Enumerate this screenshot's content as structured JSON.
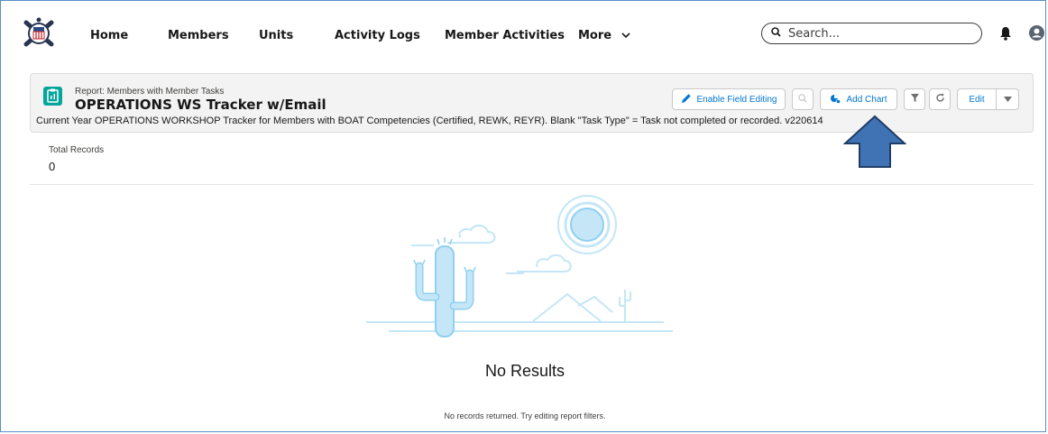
{
  "nav": {
    "items": [
      "Home",
      "Members",
      "Units",
      "Activity Logs",
      "Member Activities"
    ],
    "more_label": "More",
    "search_placeholder": "Search..."
  },
  "report": {
    "kicker": "Report: Members with Member Tasks",
    "title": "OPERATIONS WS Tracker w/Email",
    "description": "Current Year OPERATIONS WORKSHOP Tracker for Members with BOAT Competencies (Certified, REWK, REYR). Blank \"Task Type\" = Task not completed or recorded. v220614"
  },
  "toolbar": {
    "enable_field_editing": "Enable Field Editing",
    "add_chart": "Add Chart",
    "edit": "Edit"
  },
  "records": {
    "label": "Total Records",
    "value": "0"
  },
  "empty_state": {
    "title": "No Results",
    "message": "No records returned. Try editing report filters."
  },
  "colors": {
    "brand_teal": "#06a59a",
    "link_blue": "#0176d3",
    "arrow_blue": "#3f73b3",
    "illustration_blue": "#c4e6f7"
  }
}
